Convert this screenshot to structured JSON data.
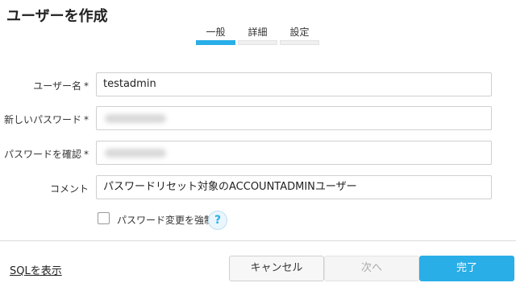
{
  "dialog": {
    "title": "ユーザーを作成"
  },
  "steps": [
    {
      "label": "一般",
      "active": true
    },
    {
      "label": "詳細",
      "active": false
    },
    {
      "label": "設定",
      "active": false
    }
  ],
  "form": {
    "username": {
      "label": "ユーザー名",
      "required_mark": "*",
      "value": "testadmin"
    },
    "password": {
      "label": "新しいパスワード",
      "required_mark": "*",
      "masked": true
    },
    "confirm_password": {
      "label": "パスワードを確認",
      "required_mark": "*",
      "masked": true
    },
    "comment": {
      "label": "コメント",
      "value": "パスワードリセット対象のACCOUNTADMINユーザー"
    },
    "force_change": {
      "label": "パスワード変更を強制",
      "checked": false,
      "help_icon": "question-icon",
      "help_text": "?"
    }
  },
  "footer": {
    "sql_link": "SQLを表示",
    "cancel": "キャンセル",
    "next": "次へ",
    "done": "完了"
  },
  "colors": {
    "accent": "#29aee8"
  }
}
